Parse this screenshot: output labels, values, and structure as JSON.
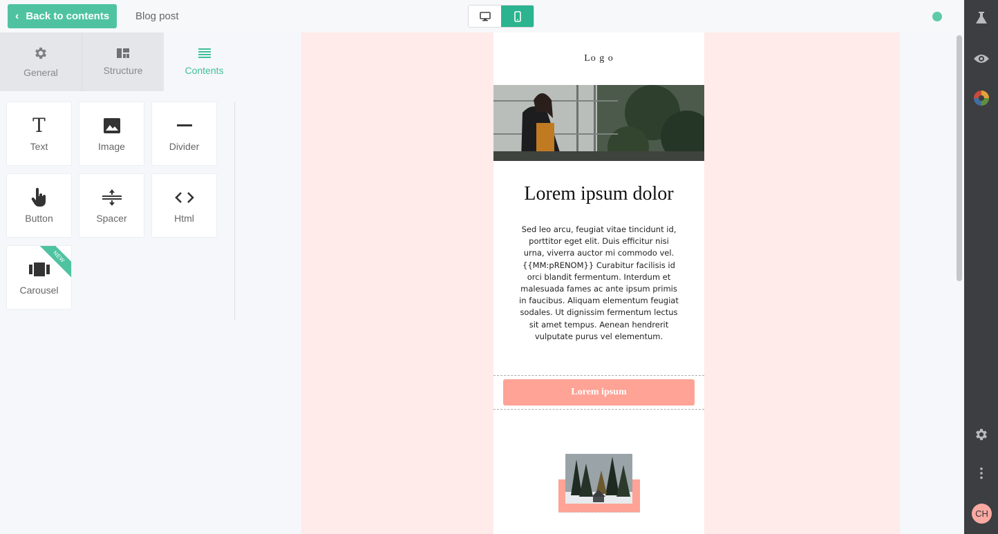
{
  "topbar": {
    "back_label": "Back to contents",
    "doc_title": "Blog post",
    "devices": [
      {
        "name": "desktop",
        "active": false
      },
      {
        "name": "mobile",
        "active": true
      }
    ]
  },
  "tabs": [
    {
      "label": "General",
      "icon": "gear-icon"
    },
    {
      "label": "Structure",
      "icon": "layout-icon"
    },
    {
      "label": "Contents",
      "icon": "list-icon",
      "active": true
    }
  ],
  "tiles": [
    {
      "label": "Text",
      "icon": "text-icon"
    },
    {
      "label": "Image",
      "icon": "image-icon"
    },
    {
      "label": "Divider",
      "icon": "divider-icon"
    },
    {
      "label": "Button",
      "icon": "hand-pointer-icon"
    },
    {
      "label": "Spacer",
      "icon": "spacer-icon"
    },
    {
      "label": "Html",
      "icon": "code-icon"
    },
    {
      "label": "Carousel",
      "icon": "carousel-icon",
      "badge": "NEW"
    }
  ],
  "email": {
    "logo": "Lo g o",
    "headline": "Lorem ipsum dolor",
    "body": "Sed leo arcu, feugiat vitae tincidunt id, porttitor eget elit. Duis efficitur nisi urna, viverra auctor mi commodo vel. {{MM:pRENOM}} Curabitur facilisis id orci blandit fermentum. Interdum et malesuada fames ac ante ipsum primis in faucibus. Aliquam elementum feugiat sodales. Ut dignissim fermentum lectus sit amet tempus. Aenean hendrerit vulputate purus vel elementum.",
    "button_label": "Lorem ipsum"
  },
  "rail": {
    "icons": [
      "flask-icon",
      "eye-icon",
      "color-wheel-icon",
      "gear-icon",
      "more-vertical-icon"
    ],
    "avatar_initials": "CH"
  },
  "colors": {
    "accent": "#4fc3a1",
    "accent_dark": "#2bb48f",
    "email_bg": "#ffebea",
    "cta": "#fea396",
    "rail": "#3c3e42"
  }
}
